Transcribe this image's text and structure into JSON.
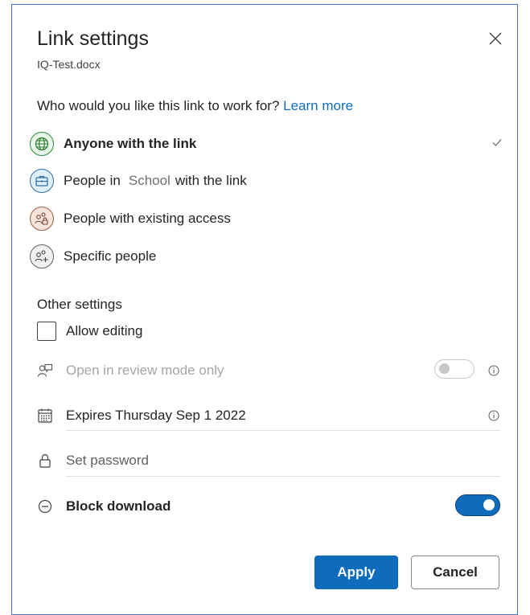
{
  "dialog": {
    "title": "Link settings",
    "filename": "IQ-Test.docx",
    "question": "Who would you like this link to work for?",
    "learn_more": "Learn more"
  },
  "options": [
    {
      "label": "Anyone with the link",
      "selected": true,
      "icon": "globe-icon"
    },
    {
      "label_before": "People in",
      "org": "School",
      "label_after": "with the link",
      "selected": false,
      "icon": "briefcase-icon"
    },
    {
      "label": "People with existing access",
      "selected": false,
      "icon": "people-lock-icon"
    },
    {
      "label": "Specific people",
      "selected": false,
      "icon": "people-add-icon"
    }
  ],
  "other_settings": {
    "heading": "Other settings",
    "allow_editing": {
      "label": "Allow editing",
      "checked": false
    },
    "review_mode": {
      "label": "Open in review mode only",
      "enabled": false,
      "on": false
    },
    "expires": {
      "label": "Expires Thursday Sep 1 2022"
    },
    "password": {
      "placeholder": "Set password"
    },
    "block_download": {
      "label": "Block download",
      "on": true
    }
  },
  "buttons": {
    "apply": "Apply",
    "cancel": "Cancel"
  },
  "colors": {
    "accent": "#0f6cbd",
    "border": "#4472c4"
  }
}
